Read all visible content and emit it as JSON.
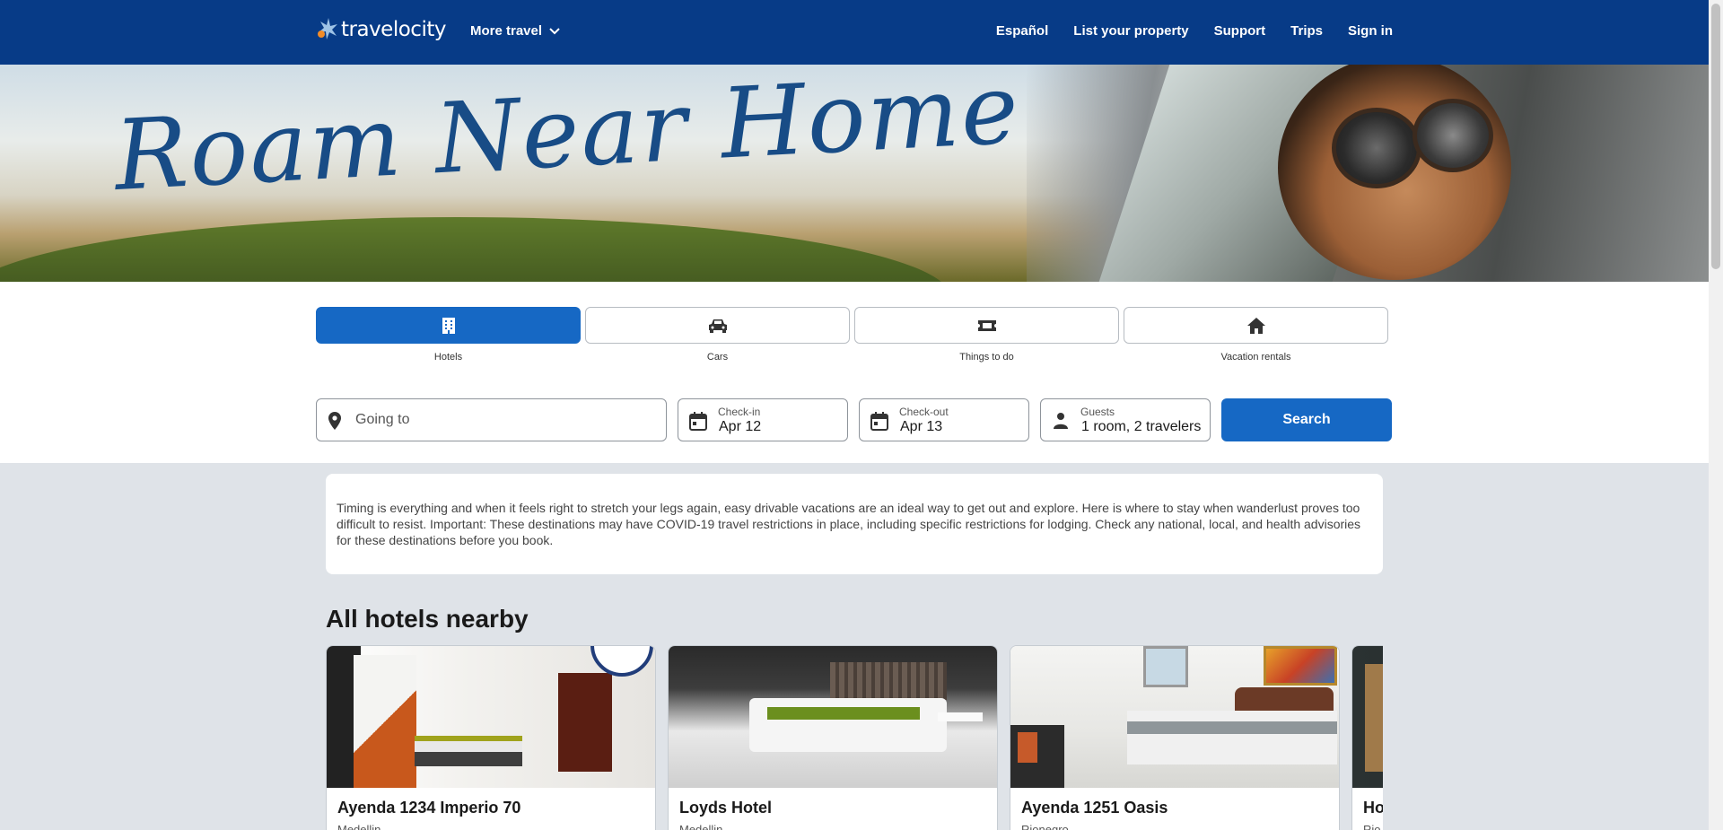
{
  "header": {
    "logo_text": "travelocity",
    "more_travel": "More travel",
    "nav": [
      "Español",
      "List your property",
      "Support",
      "Trips",
      "Sign in"
    ]
  },
  "hero": {
    "title": "Roam Near Home"
  },
  "tabs": [
    {
      "label": "Hotels",
      "icon": "building-icon",
      "active": true
    },
    {
      "label": "Cars",
      "icon": "car-icon",
      "active": false
    },
    {
      "label": "Things to do",
      "icon": "ticket-icon",
      "active": false
    },
    {
      "label": "Vacation rentals",
      "icon": "house-icon",
      "active": false
    }
  ],
  "search": {
    "going_to_placeholder": "Going to",
    "checkin_label": "Check-in",
    "checkin_value": "Apr 12",
    "checkout_label": "Check-out",
    "checkout_value": "Apr 13",
    "guests_label": "Guests",
    "guests_value": "1 room, 2 travelers",
    "button": "Search"
  },
  "intro": {
    "text": "Timing is everything and when it feels right to stretch your legs again, easy drivable vacations are an ideal way to get out and explore. Here is where to stay when wanderlust proves too difficult to resist. Important: These destinations may have COVID-19 travel restrictions in place, including specific restrictions for lodging. Check any national, local, and health advisories for these destinations before you book."
  },
  "section": {
    "title": "All hotels nearby"
  },
  "hotels": [
    {
      "name": "Ayenda 1234 Imperio 70",
      "location": "Medellin"
    },
    {
      "name": "Loyds Hotel",
      "location": "Medellin"
    },
    {
      "name": "Ayenda 1251 Oasis",
      "location": "Rionegro"
    },
    {
      "name": "Ho",
      "location": "Rio"
    }
  ],
  "colors": {
    "brand": "#073b87",
    "accent": "#1668c4",
    "background": "#dfe3e8"
  }
}
